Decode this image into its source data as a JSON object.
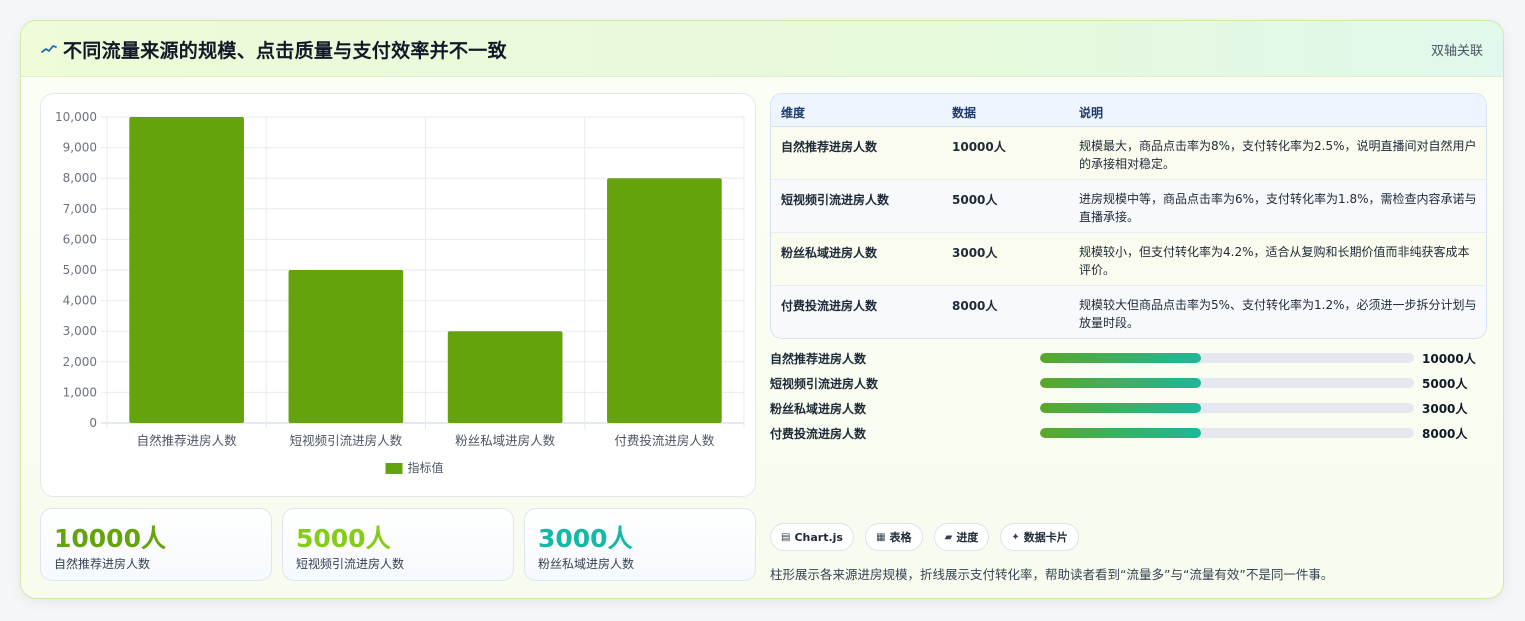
{
  "header": {
    "title": "不同流量来源的规模、点击质量与支付效率并不一致",
    "tag": "双轴关联",
    "accent_color": "#2b6cb0"
  },
  "chart_data": {
    "type": "bar",
    "categories": [
      "自然推荐进房人数",
      "短视频引流进房人数",
      "粉丝私域进房人数",
      "付费投流进房人数"
    ],
    "series": [
      {
        "name": "指标值",
        "values": [
          10000,
          5000,
          3000,
          8000
        ],
        "color": "#64a30d"
      }
    ],
    "ylim": [
      0,
      10000
    ],
    "yticks": [
      "0",
      "1,000",
      "2,000",
      "3,000",
      "4,000",
      "5,000",
      "6,000",
      "7,000",
      "8,000",
      "9,000",
      "10,000"
    ],
    "ytick_values": [
      0,
      1000,
      2000,
      3000,
      4000,
      5000,
      6000,
      7000,
      8000,
      9000,
      10000
    ],
    "grid": true,
    "legend": "bottom"
  },
  "table": {
    "headers": [
      "维度",
      "数据",
      "说明"
    ],
    "rows": [
      {
        "dim": "自然推荐进房人数",
        "value": "10000人",
        "note": "规模最大，商品点击率为8%，支付转化率为2.5%，说明直播间对自然用户的承接相对稳定。"
      },
      {
        "dim": "短视频引流进房人数",
        "value": "5000人",
        "note": "进房规模中等，商品点击率为6%，支付转化率为1.8%，需检查内容承诺与直播承接。"
      },
      {
        "dim": "粉丝私域进房人数",
        "value": "3000人",
        "note": "规模较小，但支付转化率为4.2%，适合从复购和长期价值而非纯获客成本评价。"
      },
      {
        "dim": "付费投流进房人数",
        "value": "8000人",
        "note": "规模较大但商品点击率为5%、支付转化率为1.2%，必须进一步拆分计划与放量时段。"
      }
    ]
  },
  "progress": [
    {
      "label": "自然推荐进房人数",
      "value": "10000人",
      "fraction": 0.43
    },
    {
      "label": "短视频引流进房人数",
      "value": "5000人",
      "fraction": 0.43
    },
    {
      "label": "粉丝私域进房人数",
      "value": "3000人",
      "fraction": 0.43
    },
    {
      "label": "付费投流进房人数",
      "value": "8000人",
      "fraction": 0.43
    }
  ],
  "kpis": [
    {
      "value": "10000人",
      "label": "自然推荐进房人数",
      "color": "#65a30d"
    },
    {
      "value": "5000人",
      "label": "短视频引流进房人数",
      "color": "#84cc16"
    },
    {
      "value": "3000人",
      "label": "粉丝私域进房人数",
      "color": "#14b8a6"
    }
  ],
  "chips": [
    {
      "icon": "chart-icon",
      "glyph": "▤",
      "label": "Chart.js"
    },
    {
      "icon": "table-icon",
      "glyph": "▦",
      "label": "表格"
    },
    {
      "icon": "progress-icon",
      "glyph": "▰",
      "label": "进度"
    },
    {
      "icon": "sparkle-icon",
      "glyph": "✦",
      "label": "数据卡片"
    }
  ],
  "footnote": "柱形展示各来源进房规模，折线展示支付转化率，帮助读者看到“流量多”与“流量有效”不是同一件事。"
}
